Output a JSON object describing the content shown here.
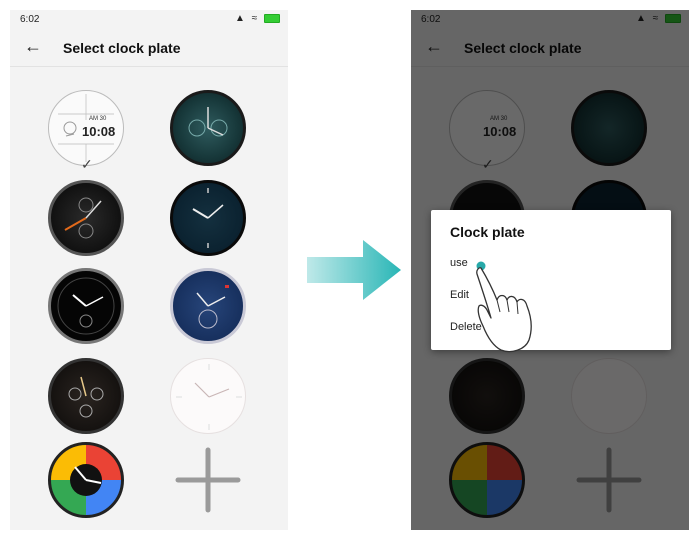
{
  "status": {
    "time": "6:02"
  },
  "appbar": {
    "title": "Select clock plate"
  },
  "dial_text": {
    "am_date": "AM 30",
    "time": "10:08"
  },
  "dialog": {
    "title": "Clock plate",
    "items": [
      "use",
      "Edit",
      "Delete"
    ]
  },
  "colors": {
    "arrow": "#29b6b6",
    "tap_dot": "#27a9a9"
  },
  "icons": [
    "back-arrow-icon",
    "checkmark-icon",
    "plus-icon",
    "pointing-hand-icon",
    "right-arrow-icon"
  ]
}
